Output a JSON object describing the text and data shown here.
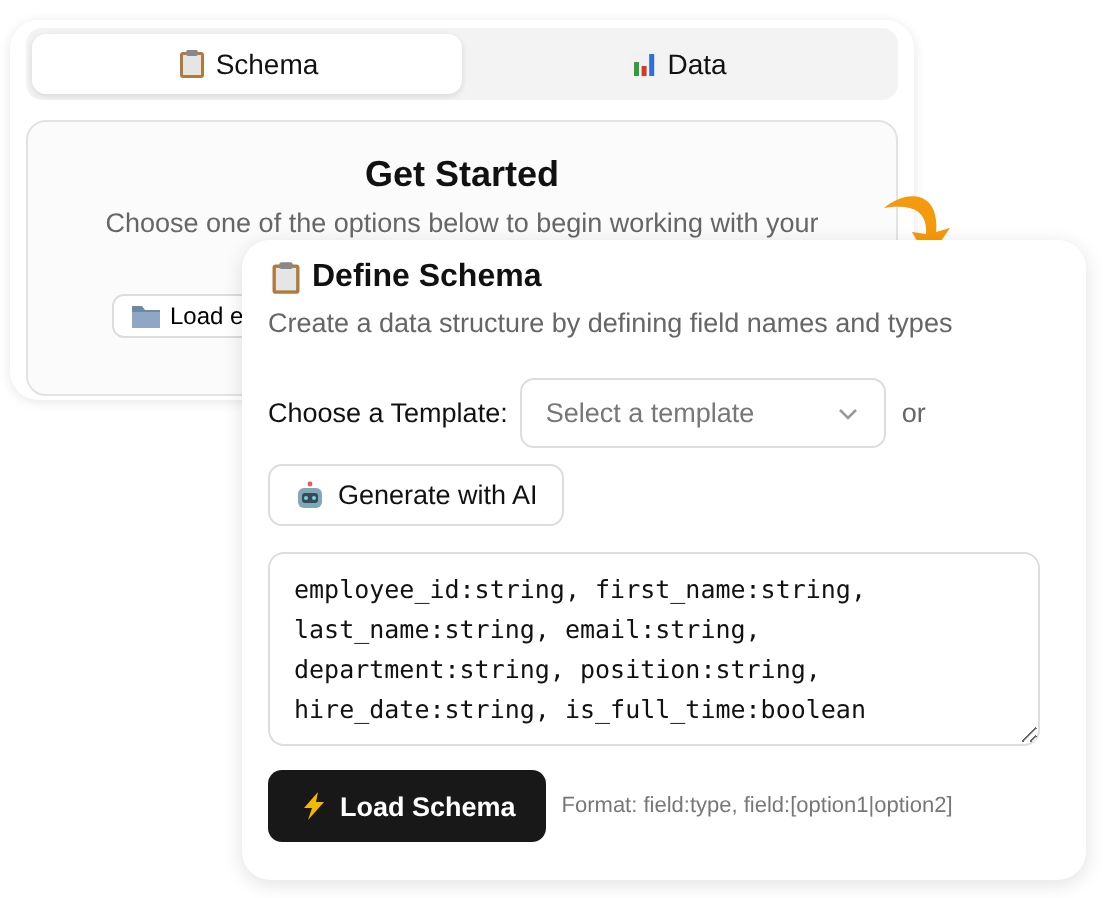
{
  "tabs": [
    {
      "label": "Schema",
      "selected": true
    },
    {
      "label": "Data",
      "selected": false
    }
  ],
  "get_started": {
    "title": "Get Started",
    "text": "Choose one of the options below to begin working with your",
    "button": "Load e"
  },
  "define_schema": {
    "title": "Define Schema",
    "description": "Create a data structure by defining field names and types",
    "template_label": "Choose a Template:",
    "template_placeholder": "Select a template",
    "or": "or",
    "generate_button": "Generate with AI",
    "schema_text": "employee_id:string, first_name:string, last_name:string, email:string, department:string, position:string, hire_date:string, is_full_time:boolean",
    "load_button": "Load Schema",
    "format_hint": "Format: field:type, field:[option1|option2]"
  }
}
